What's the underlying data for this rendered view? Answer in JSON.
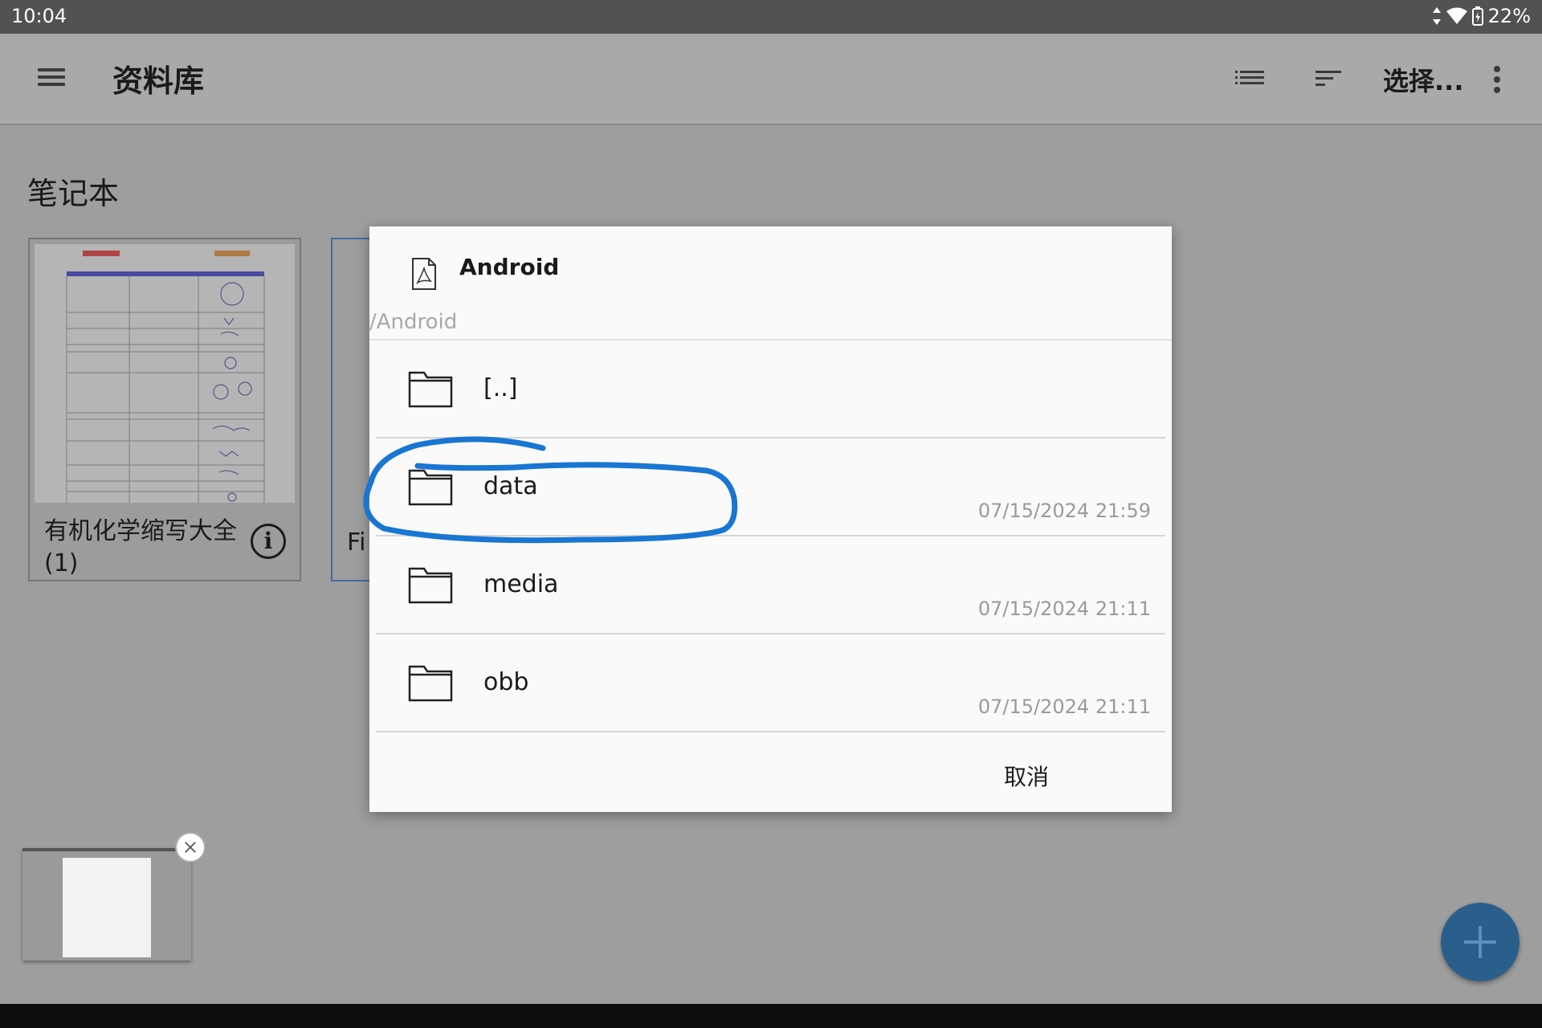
{
  "status_bar": {
    "time": "10:04",
    "battery": "22%"
  },
  "app_bar": {
    "title": "资料库",
    "select_label": "选择..."
  },
  "library": {
    "section_title": "笔记本",
    "notebook": {
      "title": "有机化学缩写大全(1)"
    },
    "notebook2": {
      "title_fragment": "Fi"
    }
  },
  "dialog": {
    "title": "Android",
    "path": "/Android",
    "items": [
      {
        "name": "[..]",
        "date": ""
      },
      {
        "name": "data",
        "date": "07/15/2024 21:59"
      },
      {
        "name": "media",
        "date": "07/15/2024 21:11"
      },
      {
        "name": "obb",
        "date": "07/15/2024 21:11"
      }
    ],
    "cancel_label": "取消"
  },
  "annotation": {
    "color": "#1976d2",
    "target": "data"
  },
  "colors": {
    "fab": "#2a5f8c",
    "scrim": "#9e9e9e"
  }
}
